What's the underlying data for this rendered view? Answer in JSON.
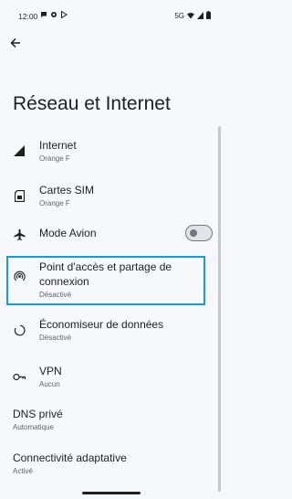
{
  "status_bar": {
    "time": "12:00",
    "network": "5G",
    "icons": [
      "chat-bubble-icon",
      "gear-icon",
      "play-store-icon",
      "wifi-icon",
      "signal-icon",
      "battery-icon"
    ]
  },
  "header": {
    "back_icon": "arrow-back-icon",
    "title": "Réseau et Internet"
  },
  "items": [
    {
      "title": "Internet",
      "subtitle": "Orange F",
      "icon": "signal-icon"
    },
    {
      "title": "Cartes SIM",
      "subtitle": "Orange F",
      "icon": "sim-card-icon"
    },
    {
      "title": "Mode Avion",
      "icon": "airplane-icon",
      "toggle": false
    },
    {
      "title": "Point d'accès et partage de connexion",
      "subtitle": "Désactivé",
      "icon": "hotspot-icon"
    },
    {
      "title": "Économiseur de données",
      "subtitle": "Désactivé",
      "icon": "data-saver-icon"
    },
    {
      "title": "VPN",
      "subtitle": "Aucun",
      "icon": "vpn-key-icon"
    },
    {
      "title": "DNS privé",
      "subtitle": "Automatique"
    },
    {
      "title": "Connectivité adaptative",
      "subtitle": "Activé"
    }
  ],
  "colors": {
    "background": "#f6f8fc",
    "highlight": "#1a9bd7",
    "subtitle": "#5f6368"
  }
}
